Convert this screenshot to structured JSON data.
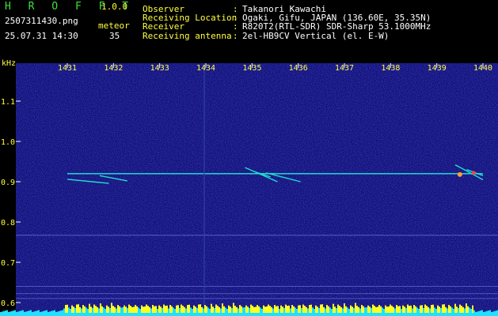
{
  "header": {
    "app_title": "H R O F F T",
    "version": "1.0.0",
    "filename": "2507311430.png",
    "datetime": "25.07.31 14:30",
    "meteor_label": "meteor",
    "meteor_count": "35",
    "info_labels": [
      "Observer",
      "Receiving Location",
      "Receiver",
      "Receiving antenna"
    ],
    "info_colons": [
      ":",
      ":",
      ":",
      ":"
    ],
    "info_values": [
      "Takanori Kawachi",
      "Ogaki, Gifu, JAPAN (136.60E, 35.35N)",
      "R820T2(RTL-SDR) SDR-Sharp 53.1000MHz",
      "2el-HB9CV Vertical (el. E-W)"
    ]
  },
  "colors": {
    "background": "#000000",
    "spectrogram": "#10106a",
    "text_yellow": "#ffff40",
    "text_white": "#ffffff",
    "title_green": "#40e040",
    "echo": "#20e0d0",
    "bottom_bar": "#ffff20",
    "bottom_bar_low": "#20e0ff"
  },
  "chart_data": {
    "type": "heatmap",
    "title": "",
    "xlabel": "",
    "ylabel": "kHz",
    "x_ticks": [
      "1431",
      "1432",
      "1433",
      "1434",
      "1435",
      "1436",
      "1437",
      "1438",
      "1439",
      "1440"
    ],
    "y_ticks": [
      "1.1",
      "1.0",
      "0.9",
      "0.8",
      "0.7",
      "0.6"
    ],
    "xlim": [
      1431,
      1440
    ],
    "ylim": [
      0.585,
      1.14
    ],
    "carrier_khz": 0.92,
    "meteor_echoes": [
      {
        "x1": 1431.0,
        "y1": 0.906,
        "x2": 1431.9,
        "y2": 0.896
      },
      {
        "x1": 1431.7,
        "y1": 0.915,
        "x2": 1432.3,
        "y2": 0.902
      },
      {
        "x1": 1434.85,
        "y1": 0.935,
        "x2": 1435.55,
        "y2": 0.9
      },
      {
        "x1": 1435.05,
        "y1": 0.925,
        "x2": 1435.4,
        "y2": 0.912
      },
      {
        "x1": 1435.3,
        "y1": 0.922,
        "x2": 1436.05,
        "y2": 0.9
      },
      {
        "x1": 1439.4,
        "y1": 0.942,
        "x2": 1440.0,
        "y2": 0.905
      },
      {
        "x1": 1439.65,
        "y1": 0.93,
        "x2": 1440.0,
        "y2": 0.915
      }
    ],
    "grid": false
  }
}
